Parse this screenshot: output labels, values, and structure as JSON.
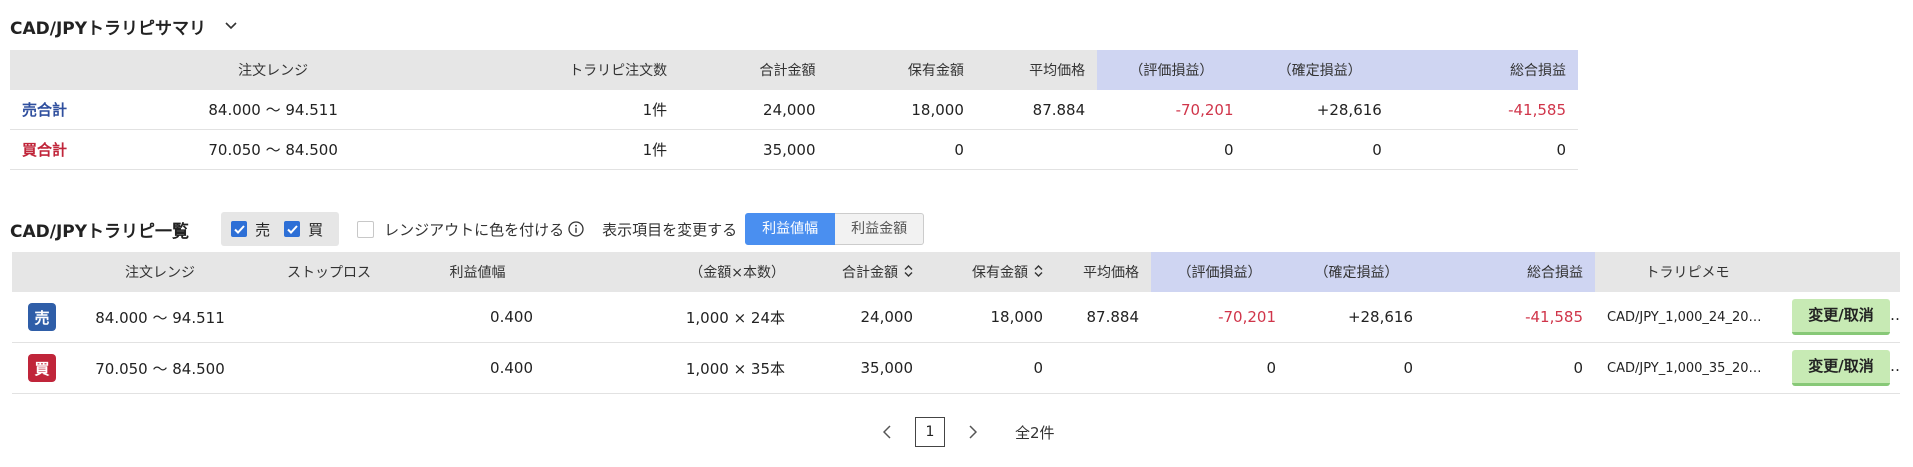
{
  "summary": {
    "title": "CAD/JPYトラリピサマリ",
    "headers": {
      "range": "注文レンジ",
      "order_count": "トラリピ注文数",
      "total_amount": "合計金額",
      "held_amount": "保有金額",
      "avg_price": "平均価格",
      "unrealized": "（評価損益）",
      "realized": "（確定損益）",
      "total_pl": "総合損益"
    },
    "rows": [
      {
        "label": "売合計",
        "range": "84.000 〜 94.511",
        "order_count": "1件",
        "total_amount": "24,000",
        "held_amount": "18,000",
        "avg_price": "87.884",
        "unrealized": "-70,201",
        "realized": "+28,616",
        "total_pl": "-41,585"
      },
      {
        "label": "買合計",
        "range": "70.050 〜 84.500",
        "order_count": "1件",
        "total_amount": "35,000",
        "held_amount": "0",
        "avg_price": "",
        "unrealized": "0",
        "realized": "0",
        "total_pl": "0"
      }
    ]
  },
  "list": {
    "title": "CAD/JPYトラリピ一覧",
    "filter_sell": "売",
    "filter_buy": "買",
    "color_out_of_range": "レンジアウトに色を付ける",
    "change_display": "表示項目を変更する",
    "toggle_on": "利益値幅",
    "toggle_off": "利益金額",
    "headers": {
      "range": "注文レンジ",
      "stop_loss": "ストップロス",
      "profit_width": "利益値幅",
      "amount_count": "（金額×本数）",
      "total_amount": "合計金額",
      "held_amount": "保有金額",
      "avg_price": "平均価格",
      "unrealized": "（評価損益）",
      "realized": "（確定損益）",
      "total_pl": "総合損益",
      "memo": "トラリピメモ"
    },
    "rows": [
      {
        "side": "売",
        "range": "84.000 〜 94.511",
        "stop_loss": "",
        "profit_width": "0.400",
        "amount_count": "1,000 × 24本",
        "total_amount": "24,000",
        "held_amount": "18,000",
        "avg_price": "87.884",
        "unrealized": "-70,201",
        "realized": "+28,616",
        "total_pl": "-41,585",
        "memo": "CAD/JPY_1,000_24_20…",
        "action": "変更/取消"
      },
      {
        "side": "買",
        "range": "70.050 〜 84.500",
        "stop_loss": "",
        "profit_width": "0.400",
        "amount_count": "1,000 × 35本",
        "total_amount": "35,000",
        "held_amount": "0",
        "avg_price": "",
        "unrealized": "0",
        "realized": "0",
        "total_pl": "0",
        "memo": "CAD/JPY_1,000_35_20…",
        "action": "変更/取消"
      }
    ]
  },
  "pagination": {
    "current": "1",
    "total": "全2件"
  },
  "colors": {
    "sell": "#2f5ea8",
    "buy": "#c0253a",
    "negative": "#d0354a",
    "accent": "#4a8ff0",
    "action": "#c7eab4"
  },
  "icons": {
    "dropdown": "chevron-down-icon",
    "info": "info-icon",
    "sort": "sort-icon",
    "check": "check-icon",
    "prev": "chevron-left-icon",
    "next": "chevron-right-icon"
  }
}
